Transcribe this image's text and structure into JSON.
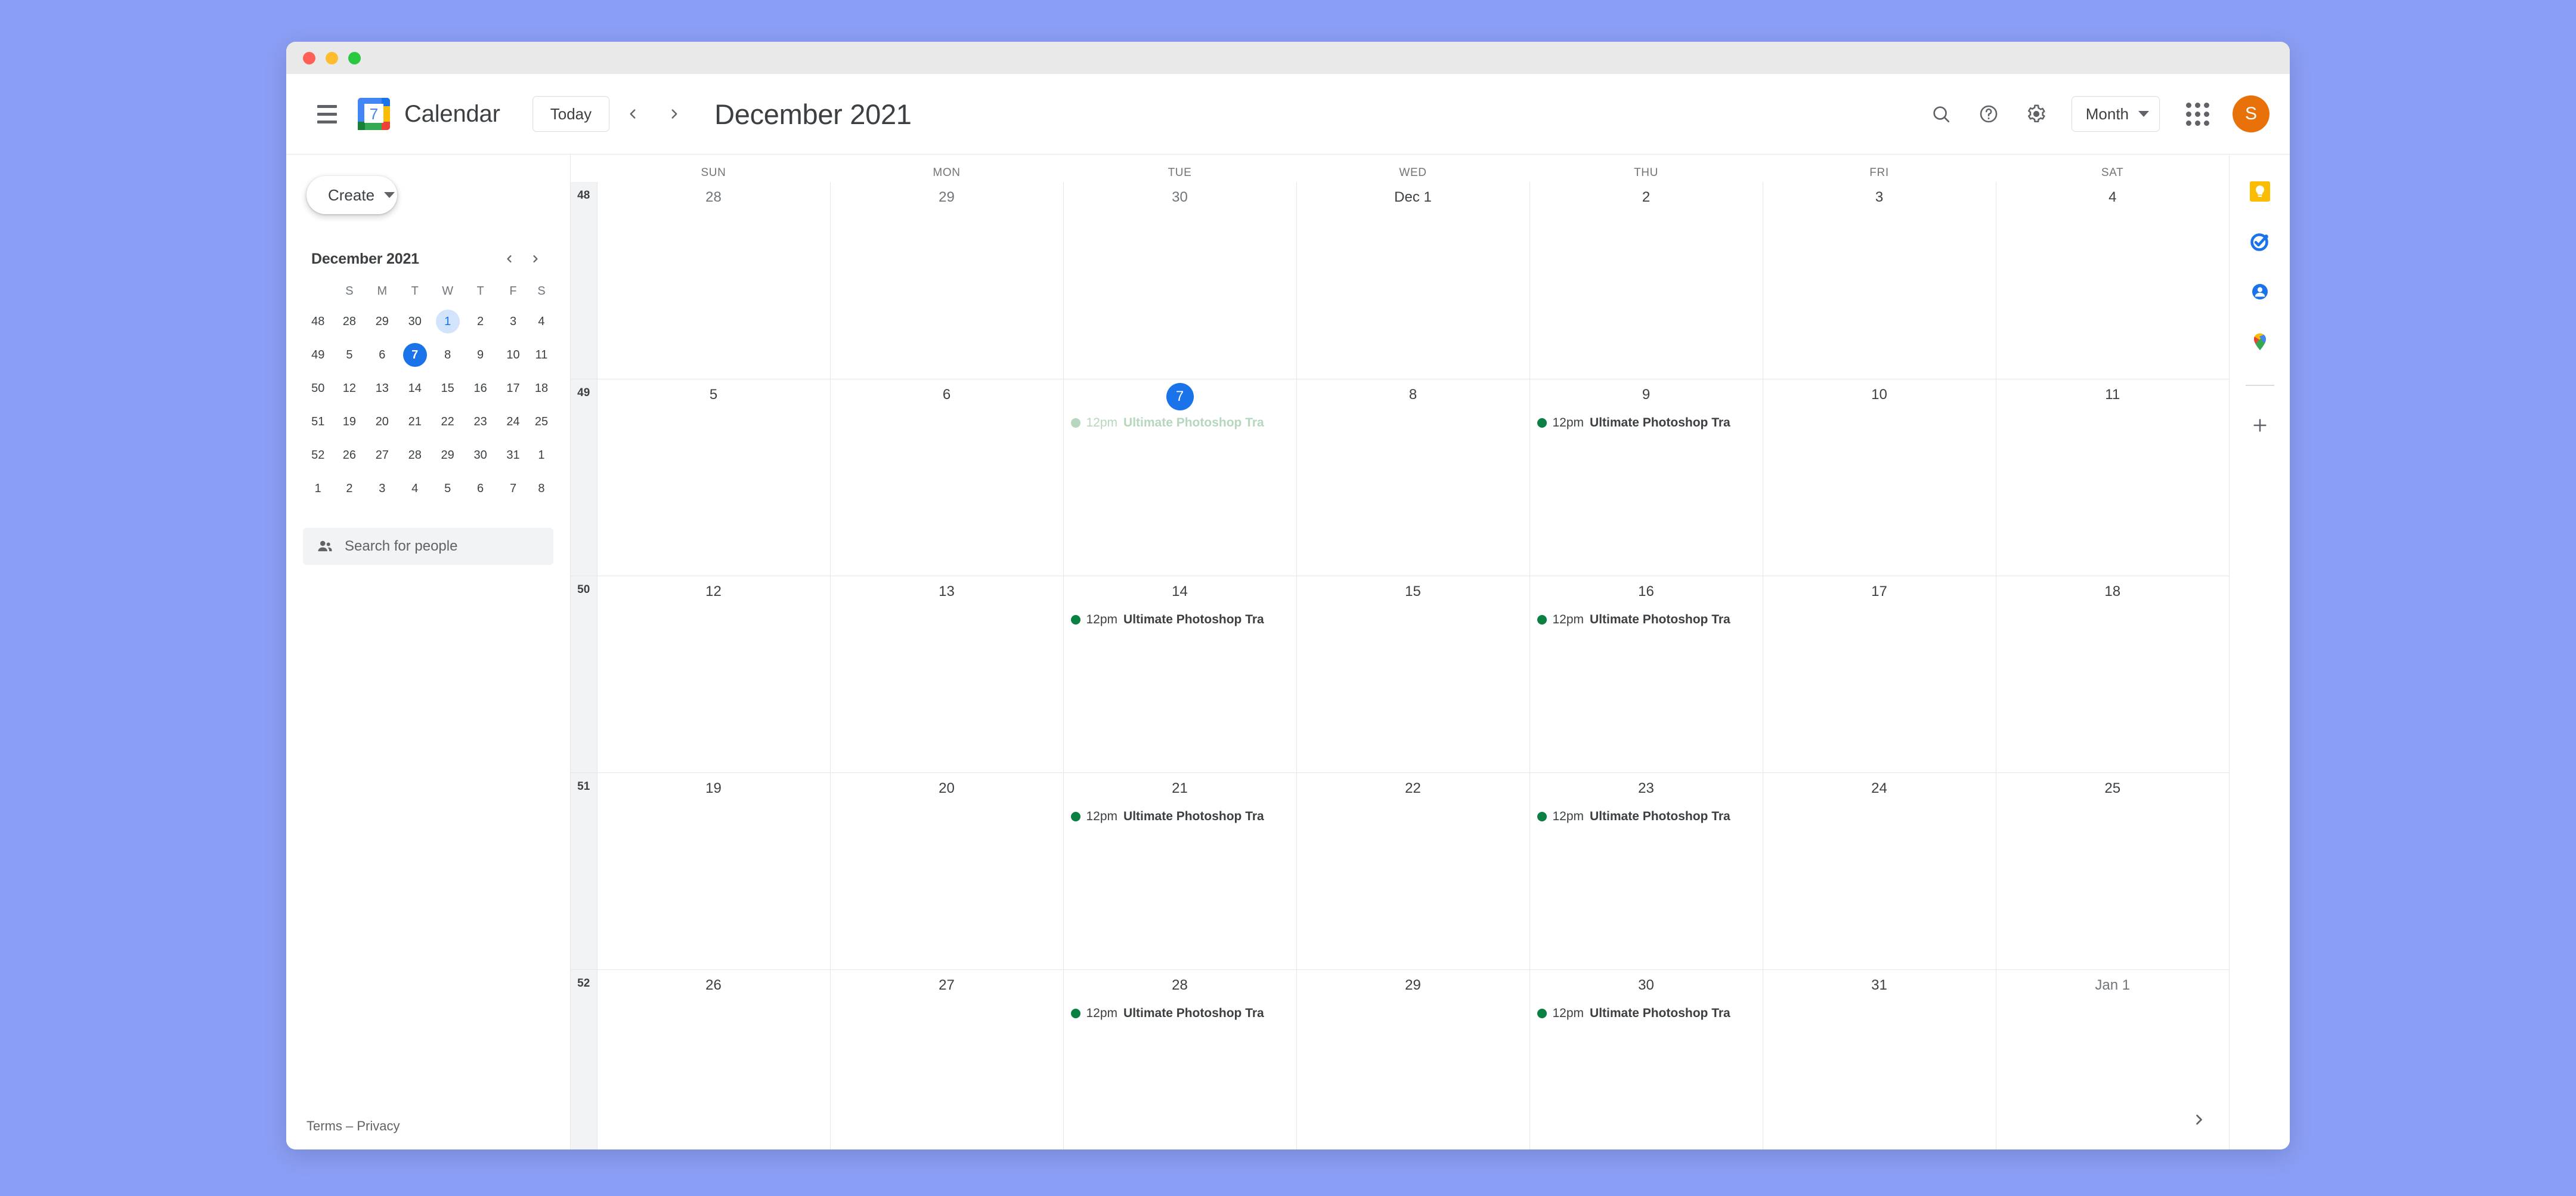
{
  "window": {
    "traffic_lights": [
      "close",
      "minimize",
      "maximize"
    ]
  },
  "header": {
    "menu_icon": "hamburger-menu-icon",
    "logo_icon": "google-calendar-logo",
    "logo_day": "7",
    "brand": "Calendar",
    "today_label": "Today",
    "prev_icon": "chevron-left-icon",
    "next_icon": "chevron-right-icon",
    "title": "December 2021",
    "search_icon": "search-icon",
    "help_icon": "help-icon",
    "settings_icon": "gear-icon",
    "view": "Month",
    "apps_icon": "apps-grid-icon",
    "avatar_initial": "S",
    "avatar_color": "#E8710A"
  },
  "sidebar": {
    "create_label": "Create",
    "create_caret": "chevron-down-icon",
    "mini_calendar": {
      "title": "December 2021",
      "prev_icon": "chevron-left-icon",
      "next_icon": "chevron-right-icon",
      "weekday_headers": [
        "S",
        "M",
        "T",
        "W",
        "T",
        "F",
        "S"
      ],
      "weeks": [
        {
          "week": "48",
          "days": [
            {
              "d": "28",
              "state": "muted"
            },
            {
              "d": "29",
              "state": "muted"
            },
            {
              "d": "30",
              "state": "muted"
            },
            {
              "d": "1",
              "state": "selected"
            },
            {
              "d": "2",
              "state": "normal"
            },
            {
              "d": "3",
              "state": "normal"
            },
            {
              "d": "4",
              "state": "normal"
            }
          ]
        },
        {
          "week": "49",
          "days": [
            {
              "d": "5",
              "state": "normal"
            },
            {
              "d": "6",
              "state": "normal"
            },
            {
              "d": "7",
              "state": "today"
            },
            {
              "d": "8",
              "state": "normal"
            },
            {
              "d": "9",
              "state": "normal"
            },
            {
              "d": "10",
              "state": "normal"
            },
            {
              "d": "11",
              "state": "normal"
            }
          ]
        },
        {
          "week": "50",
          "days": [
            {
              "d": "12",
              "state": "normal"
            },
            {
              "d": "13",
              "state": "normal"
            },
            {
              "d": "14",
              "state": "normal"
            },
            {
              "d": "15",
              "state": "normal"
            },
            {
              "d": "16",
              "state": "normal"
            },
            {
              "d": "17",
              "state": "normal"
            },
            {
              "d": "18",
              "state": "normal"
            }
          ]
        },
        {
          "week": "51",
          "days": [
            {
              "d": "19",
              "state": "normal"
            },
            {
              "d": "20",
              "state": "normal"
            },
            {
              "d": "21",
              "state": "normal"
            },
            {
              "d": "22",
              "state": "normal"
            },
            {
              "d": "23",
              "state": "normal"
            },
            {
              "d": "24",
              "state": "normal"
            },
            {
              "d": "25",
              "state": "normal"
            }
          ]
        },
        {
          "week": "52",
          "days": [
            {
              "d": "26",
              "state": "normal"
            },
            {
              "d": "27",
              "state": "normal"
            },
            {
              "d": "28",
              "state": "normal"
            },
            {
              "d": "29",
              "state": "normal"
            },
            {
              "d": "30",
              "state": "normal"
            },
            {
              "d": "31",
              "state": "normal"
            },
            {
              "d": "1",
              "state": "muted"
            }
          ]
        },
        {
          "week": "1",
          "days": [
            {
              "d": "2",
              "state": "muted"
            },
            {
              "d": "3",
              "state": "muted"
            },
            {
              "d": "4",
              "state": "muted"
            },
            {
              "d": "5",
              "state": "muted"
            },
            {
              "d": "6",
              "state": "muted"
            },
            {
              "d": "7",
              "state": "muted"
            },
            {
              "d": "8",
              "state": "muted"
            }
          ]
        }
      ]
    },
    "search_people_icon": "people-icon",
    "search_people_placeholder": "Search for people",
    "footer": "Terms – Privacy"
  },
  "calendar_grid": {
    "weekday_headers": [
      "SUN",
      "MON",
      "TUE",
      "WED",
      "THU",
      "FRI",
      "SAT"
    ],
    "rows": [
      {
        "week": "48",
        "days": [
          {
            "label": "28",
            "type": "prev",
            "events": []
          },
          {
            "label": "29",
            "type": "prev",
            "events": []
          },
          {
            "label": "30",
            "type": "prev",
            "events": []
          },
          {
            "label": "Dec 1",
            "type": "current",
            "events": []
          },
          {
            "label": "2",
            "type": "current",
            "events": []
          },
          {
            "label": "3",
            "type": "current",
            "events": []
          },
          {
            "label": "4",
            "type": "current",
            "events": []
          }
        ]
      },
      {
        "week": "49",
        "days": [
          {
            "label": "5",
            "type": "current",
            "events": []
          },
          {
            "label": "6",
            "type": "current",
            "events": []
          },
          {
            "label": "7",
            "type": "today",
            "events": [
              {
                "time": "12pm",
                "title": "Ultimate Photoshop Tra",
                "color": "#0b8043",
                "past": true
              }
            ]
          },
          {
            "label": "8",
            "type": "current",
            "events": []
          },
          {
            "label": "9",
            "type": "current",
            "events": [
              {
                "time": "12pm",
                "title": "Ultimate Photoshop Tra",
                "color": "#0b8043",
                "past": false
              }
            ]
          },
          {
            "label": "10",
            "type": "current",
            "events": []
          },
          {
            "label": "11",
            "type": "current",
            "events": []
          }
        ]
      },
      {
        "week": "50",
        "days": [
          {
            "label": "12",
            "type": "current",
            "events": []
          },
          {
            "label": "13",
            "type": "current",
            "events": []
          },
          {
            "label": "14",
            "type": "current",
            "events": [
              {
                "time": "12pm",
                "title": "Ultimate Photoshop Tra",
                "color": "#0b8043",
                "past": false
              }
            ]
          },
          {
            "label": "15",
            "type": "current",
            "events": []
          },
          {
            "label": "16",
            "type": "current",
            "events": [
              {
                "time": "12pm",
                "title": "Ultimate Photoshop Tra",
                "color": "#0b8043",
                "past": false
              }
            ]
          },
          {
            "label": "17",
            "type": "current",
            "events": []
          },
          {
            "label": "18",
            "type": "current",
            "events": []
          }
        ]
      },
      {
        "week": "51",
        "days": [
          {
            "label": "19",
            "type": "current",
            "events": []
          },
          {
            "label": "20",
            "type": "current",
            "events": []
          },
          {
            "label": "21",
            "type": "current",
            "events": [
              {
                "time": "12pm",
                "title": "Ultimate Photoshop Tra",
                "color": "#0b8043",
                "past": false
              }
            ]
          },
          {
            "label": "22",
            "type": "current",
            "events": []
          },
          {
            "label": "23",
            "type": "current",
            "events": [
              {
                "time": "12pm",
                "title": "Ultimate Photoshop Tra",
                "color": "#0b8043",
                "past": false
              }
            ]
          },
          {
            "label": "24",
            "type": "current",
            "events": []
          },
          {
            "label": "25",
            "type": "current",
            "events": []
          }
        ]
      },
      {
        "week": "52",
        "days": [
          {
            "label": "26",
            "type": "current",
            "events": []
          },
          {
            "label": "27",
            "type": "current",
            "events": []
          },
          {
            "label": "28",
            "type": "current",
            "events": [
              {
                "time": "12pm",
                "title": "Ultimate Photoshop Tra",
                "color": "#0b8043",
                "past": false
              }
            ]
          },
          {
            "label": "29",
            "type": "current",
            "events": []
          },
          {
            "label": "30",
            "type": "current",
            "events": [
              {
                "time": "12pm",
                "title": "Ultimate Photoshop Tra",
                "color": "#0b8043",
                "past": false
              }
            ]
          },
          {
            "label": "31",
            "type": "current",
            "events": []
          },
          {
            "label": "Jan 1",
            "type": "next",
            "events": []
          }
        ]
      }
    ],
    "expand_icon": "chevron-right-icon"
  },
  "right_rail": {
    "items": [
      {
        "icon": "google-keep-icon"
      },
      {
        "icon": "google-tasks-icon"
      },
      {
        "icon": "google-contacts-icon"
      },
      {
        "icon": "google-maps-icon"
      }
    ],
    "add_icon": "plus-icon"
  }
}
